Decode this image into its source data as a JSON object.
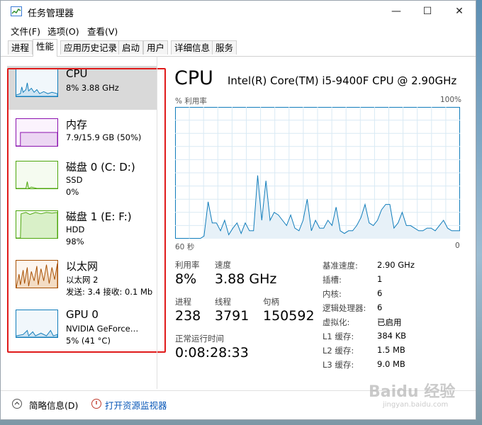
{
  "window": {
    "title": "任务管理器",
    "controls": {
      "minimize": "—",
      "maximize": "☐",
      "close": "✕"
    }
  },
  "menu": [
    "文件(F)",
    "选项(O)",
    "查看(V)"
  ],
  "tabs": [
    "进程",
    "性能",
    "应用历史记录",
    "启动",
    "用户",
    "详细信息",
    "服务"
  ],
  "active_tab": "性能",
  "sidebar": {
    "items": [
      {
        "title": "CPU",
        "line1": "8% 3.88 GHz",
        "color": "#117dbb"
      },
      {
        "title": "内存",
        "line1": "7.9/15.9 GB (50%)",
        "color": "#8b12ae"
      },
      {
        "title": "磁盘 0 (C: D:)",
        "line1": "SSD",
        "line2": "0%",
        "color": "#4da60c"
      },
      {
        "title": "磁盘 1 (E: F:)",
        "line1": "HDD",
        "line2": "98%",
        "color": "#4da60c"
      },
      {
        "title": "以太网",
        "line1": "以太网 2",
        "line2": "发送: 3.4  接收: 0.1 Mb",
        "color": "#a74f01"
      },
      {
        "title": "GPU 0",
        "line1": "NVIDIA GeForce…",
        "line2": "5% (41 °C)",
        "color": "#117dbb"
      }
    ]
  },
  "detail": {
    "heading": "CPU",
    "model": "Intel(R) Core(TM) i5-9400F CPU @ 2.90GHz",
    "graph_label": "% 利用率",
    "graph_max": "100%",
    "graph_time_left": "60 秒",
    "graph_time_right": "0",
    "stats": {
      "utilization_label": "利用率",
      "utilization": "8%",
      "speed_label": "速度",
      "speed": "3.88 GHz",
      "processes_label": "进程",
      "processes": "238",
      "threads_label": "线程",
      "threads": "3791",
      "handles_label": "句柄",
      "handles": "150592",
      "uptime_label": "正常运行时间",
      "uptime": "0:08:28:33"
    },
    "specs": [
      {
        "key": "基准速度:",
        "value": "2.90 GHz"
      },
      {
        "key": "插槽:",
        "value": "1"
      },
      {
        "key": "内核:",
        "value": "6"
      },
      {
        "key": "逻辑处理器:",
        "value": "6"
      },
      {
        "key": "虚拟化:",
        "value": "已启用"
      },
      {
        "key": "L1 缓存:",
        "value": "384 KB"
      },
      {
        "key": "L2 缓存:",
        "value": "1.5 MB"
      },
      {
        "key": "L3 缓存:",
        "value": "9.0 MB"
      }
    ]
  },
  "footer": {
    "fewer_details": "简略信息(D)",
    "open_monitor": "打开资源监视器"
  },
  "watermark": {
    "main": "Baidu 经验",
    "sub": "jingyan.baidu.com"
  },
  "cpu_history": [
    0,
    0,
    0,
    0,
    0,
    0,
    0,
    2,
    28,
    12,
    12,
    6,
    14,
    3,
    8,
    12,
    4,
    12,
    6,
    6,
    48,
    14,
    44,
    14,
    20,
    18,
    14,
    10,
    18,
    8,
    6,
    14,
    30,
    6,
    14,
    8,
    8,
    14,
    10,
    24,
    6,
    4,
    6,
    6,
    10,
    16,
    26,
    12,
    10,
    14,
    22,
    26,
    26,
    8,
    12,
    20,
    10,
    10,
    8,
    6,
    6,
    8,
    8,
    6,
    10,
    14,
    8,
    6,
    6,
    6
  ]
}
